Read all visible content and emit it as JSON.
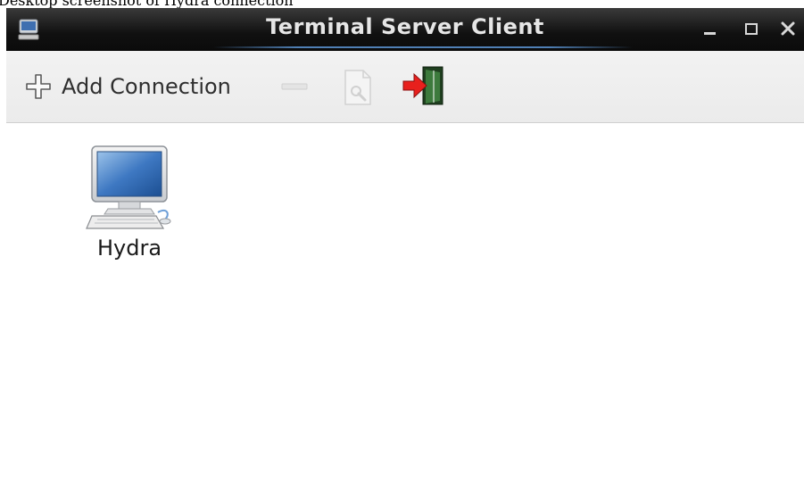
{
  "top_strip_text": "Desktop screenshot of Hydra connection",
  "window": {
    "title": "Terminal Server Client",
    "app_icon": "computer-icon",
    "controls": [
      "minimize-icon",
      "maximize-icon",
      "close-icon"
    ]
  },
  "toolbar": {
    "add_label": "Add Connection",
    "add_icon": "plus-icon",
    "remove_icon": "minus-icon",
    "properties_icon": "properties-icon",
    "quit_icon": "exit-door-icon"
  },
  "connections": [
    {
      "name": "Hydra",
      "icon": "computer-icon"
    }
  ],
  "colors": {
    "titlebar": "#111111",
    "title_text": "#e6e6e6",
    "toolbar_bg": "#efefef",
    "accent": "#4f7fb4",
    "quit_red": "#e8201d",
    "quit_green": "#2f6b2f"
  }
}
